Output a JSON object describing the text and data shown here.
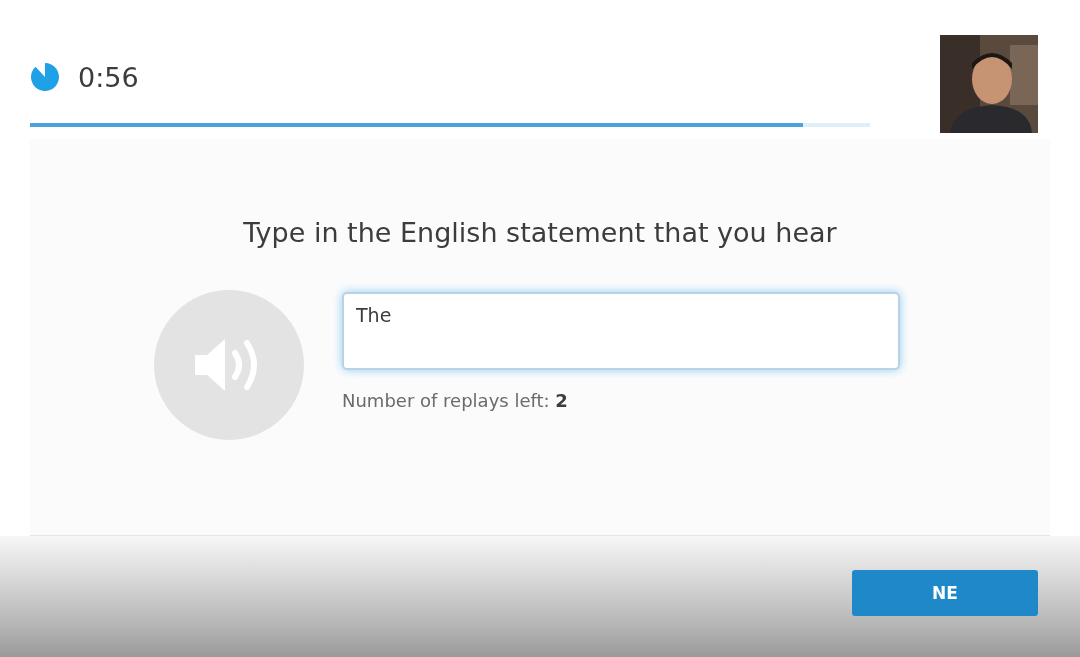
{
  "timer": {
    "time": "0:56"
  },
  "progress": {
    "level": 0.92
  },
  "question": {
    "title": "Type in the English statement that you hear",
    "answer": {
      "value": "The "
    },
    "replays": "Number of replays left: **2**"
  },
  "footer": {
    "button": "NE"
  }
}
